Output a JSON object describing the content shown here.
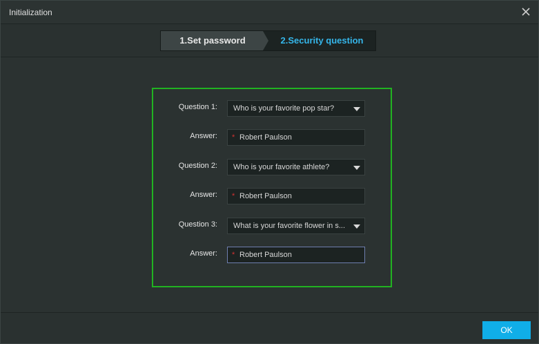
{
  "window": {
    "title": "Initialization"
  },
  "steps": [
    {
      "label": "1.Set password",
      "active": false
    },
    {
      "label": "2.Security question",
      "active": true
    }
  ],
  "form": {
    "questions": [
      {
        "label": "Question 1:",
        "selected": "Who is your favorite pop star?",
        "answer_label": "Answer:",
        "answer_value": "Robert Paulson"
      },
      {
        "label": "Question 2:",
        "selected": "Who is your favorite athlete?",
        "answer_label": "Answer:",
        "answer_value": "Robert Paulson"
      },
      {
        "label": "Question 3:",
        "selected": "What is your favorite flower in s...",
        "answer_label": "Answer:",
        "answer_value": "Robert Paulson"
      }
    ],
    "required_mark": "*"
  },
  "footer": {
    "ok_label": "OK"
  },
  "colors": {
    "accent": "#10aee8",
    "active_step": "#35b6ea",
    "highlight_border": "#21b321",
    "required": "#d33232"
  },
  "icons": {
    "close": "close-icon",
    "dropdown": "chevron-down-icon"
  }
}
